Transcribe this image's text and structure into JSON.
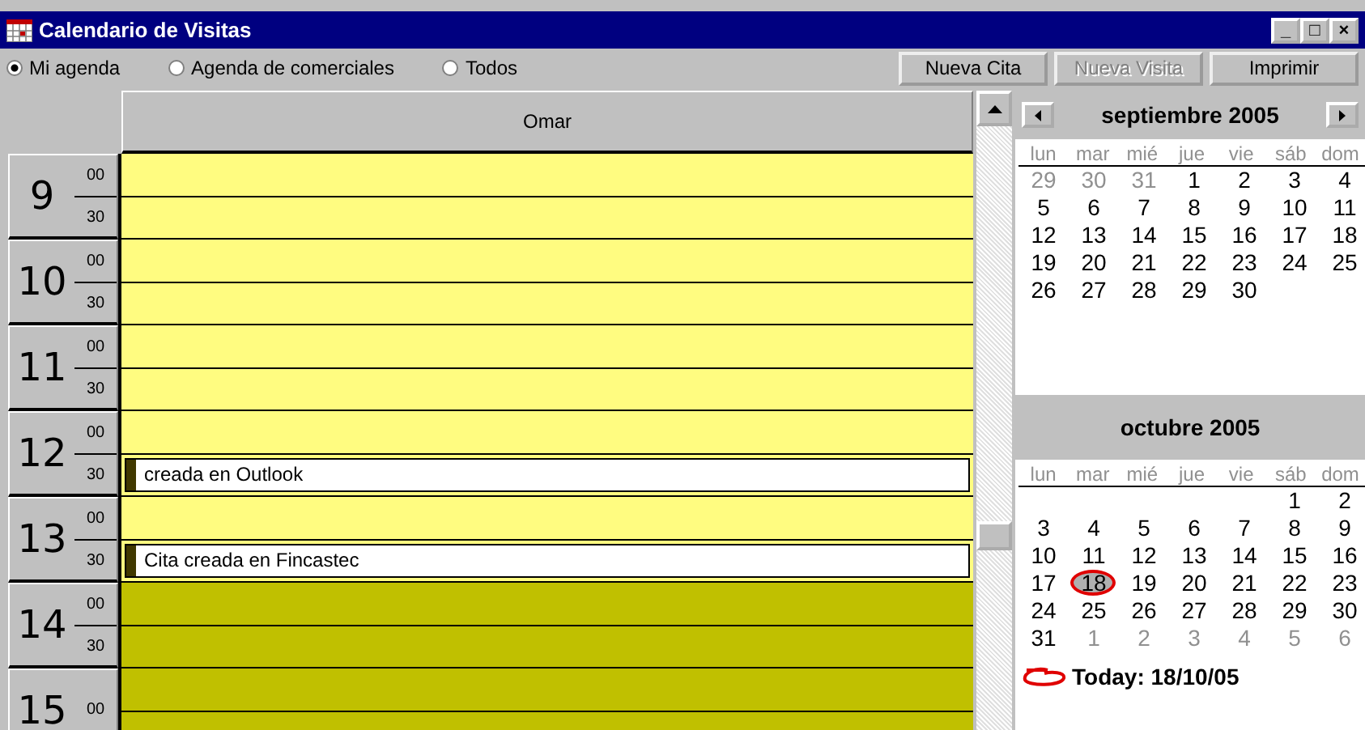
{
  "window": {
    "title": "Calendario de Visitas",
    "controls": [
      "_",
      "□",
      "×"
    ]
  },
  "view_options": [
    {
      "label": "Mi agenda",
      "selected": true
    },
    {
      "label": "Agenda de comerciales",
      "selected": false
    },
    {
      "label": "Todos",
      "selected": false
    }
  ],
  "buttons": [
    {
      "label": "Nueva Cita",
      "disabled": false
    },
    {
      "label": "Nueva Visita",
      "disabled": true
    },
    {
      "label": "Imprimir",
      "disabled": false
    }
  ],
  "schedule": {
    "column": "Omar",
    "hours": [
      {
        "hour": "9",
        "minutes": [
          "00",
          "30"
        ],
        "slots": [
          {
            "kind": "work"
          },
          {
            "kind": "work"
          }
        ]
      },
      {
        "hour": "10",
        "minutes": [
          "00",
          "30"
        ],
        "slots": [
          {
            "kind": "work"
          },
          {
            "kind": "work"
          }
        ]
      },
      {
        "hour": "11",
        "minutes": [
          "00",
          "30"
        ],
        "slots": [
          {
            "kind": "work"
          },
          {
            "kind": "work"
          }
        ]
      },
      {
        "hour": "12",
        "minutes": [
          "00",
          "30"
        ],
        "slots": [
          {
            "kind": "work"
          },
          {
            "kind": "work",
            "appointment": "creada en Outlook"
          }
        ]
      },
      {
        "hour": "13",
        "minutes": [
          "00",
          "30"
        ],
        "slots": [
          {
            "kind": "work"
          },
          {
            "kind": "work",
            "appointment": "Cita creada en Fincastec"
          }
        ]
      },
      {
        "hour": "14",
        "minutes": [
          "00",
          "30"
        ],
        "slots": [
          {
            "kind": "off"
          },
          {
            "kind": "off"
          }
        ]
      },
      {
        "hour": "15",
        "minutes": [
          "00"
        ],
        "slots": [
          {
            "kind": "off"
          },
          {
            "kind": "off"
          }
        ]
      }
    ]
  },
  "calendar": {
    "months": [
      {
        "title": "septiembre 2005",
        "kind": "navigable",
        "weekdays": [
          "lun",
          "mar",
          "mié",
          "jue",
          "vie",
          "sáb",
          "dom"
        ],
        "weeks": [
          [
            {
              "day": "29",
              "other": true,
              "selected": false
            },
            {
              "day": "30",
              "other": true,
              "selected": false
            },
            {
              "day": "31",
              "other": true,
              "selected": false
            },
            {
              "day": "1",
              "other": false,
              "selected": false
            },
            {
              "day": "2",
              "other": false,
              "selected": false
            },
            {
              "day": "3",
              "other": false,
              "selected": false
            },
            {
              "day": "4",
              "other": false,
              "selected": false
            }
          ],
          [
            {
              "day": "5",
              "other": false,
              "selected": false
            },
            {
              "day": "6",
              "other": false,
              "selected": false
            },
            {
              "day": "7",
              "other": false,
              "selected": false
            },
            {
              "day": "8",
              "other": false,
              "selected": false
            },
            {
              "day": "9",
              "other": false,
              "selected": false
            },
            {
              "day": "10",
              "other": false,
              "selected": false
            },
            {
              "day": "11",
              "other": false,
              "selected": false
            }
          ],
          [
            {
              "day": "12",
              "other": false,
              "selected": false
            },
            {
              "day": "13",
              "other": false,
              "selected": false
            },
            {
              "day": "14",
              "other": false,
              "selected": false
            },
            {
              "day": "15",
              "other": false,
              "selected": false
            },
            {
              "day": "16",
              "other": false,
              "selected": false
            },
            {
              "day": "17",
              "other": false,
              "selected": false
            },
            {
              "day": "18",
              "other": false,
              "selected": false
            }
          ],
          [
            {
              "day": "19",
              "other": false,
              "selected": false
            },
            {
              "day": "20",
              "other": false,
              "selected": false
            },
            {
              "day": "21",
              "other": false,
              "selected": false
            },
            {
              "day": "22",
              "other": false,
              "selected": false
            },
            {
              "day": "23",
              "other": false,
              "selected": false
            },
            {
              "day": "24",
              "other": false,
              "selected": false
            },
            {
              "day": "25",
              "other": false,
              "selected": false
            }
          ],
          [
            {
              "day": "26",
              "other": false,
              "selected": false
            },
            {
              "day": "27",
              "other": false,
              "selected": false
            },
            {
              "day": "28",
              "other": false,
              "selected": false
            },
            {
              "day": "29",
              "other": false,
              "selected": false
            },
            {
              "day": "30",
              "other": false,
              "selected": false
            }
          ]
        ]
      },
      {
        "title": "octubre 2005",
        "kind": "plain",
        "weekdays": [
          "lun",
          "mar",
          "mié",
          "jue",
          "vie",
          "sáb",
          "dom"
        ],
        "weeks": [
          [
            {
              "day": "1",
              "other": false,
              "selected": false
            },
            {
              "day": "2",
              "other": false,
              "selected": false
            }
          ],
          [
            {
              "day": "3",
              "other": false,
              "selected": false
            },
            {
              "day": "4",
              "other": false,
              "selected": false
            },
            {
              "day": "5",
              "other": false,
              "selected": false
            },
            {
              "day": "6",
              "other": false,
              "selected": false
            },
            {
              "day": "7",
              "other": false,
              "selected": false
            },
            {
              "day": "8",
              "other": false,
              "selected": false
            },
            {
              "day": "9",
              "other": false,
              "selected": false
            }
          ],
          [
            {
              "day": "10",
              "other": false,
              "selected": false
            },
            {
              "day": "11",
              "other": false,
              "selected": false
            },
            {
              "day": "12",
              "other": false,
              "selected": false
            },
            {
              "day": "13",
              "other": false,
              "selected": false
            },
            {
              "day": "14",
              "other": false,
              "selected": false
            },
            {
              "day": "15",
              "other": false,
              "selected": false
            },
            {
              "day": "16",
              "other": false,
              "selected": false
            }
          ],
          [
            {
              "day": "17",
              "other": false,
              "selected": false
            },
            {
              "day": "18",
              "other": false,
              "selected": true
            },
            {
              "day": "19",
              "other": false,
              "selected": false
            },
            {
              "day": "20",
              "other": false,
              "selected": false
            },
            {
              "day": "21",
              "other": false,
              "selected": false
            },
            {
              "day": "22",
              "other": false,
              "selected": false
            },
            {
              "day": "23",
              "other": false,
              "selected": false
            }
          ],
          [
            {
              "day": "24",
              "other": false,
              "selected": false
            },
            {
              "day": "25",
              "other": false,
              "selected": false
            },
            {
              "day": "26",
              "other": false,
              "selected": false
            },
            {
              "day": "27",
              "other": false,
              "selected": false
            },
            {
              "day": "28",
              "other": false,
              "selected": false
            },
            {
              "day": "29",
              "other": false,
              "selected": false
            },
            {
              "day": "30",
              "other": false,
              "selected": false
            }
          ],
          [
            {
              "day": "31",
              "other": false,
              "selected": false
            },
            {
              "day": "1",
              "other": true,
              "selected": false
            },
            {
              "day": "2",
              "other": true,
              "selected": false
            },
            {
              "day": "3",
              "other": true,
              "selected": false
            },
            {
              "day": "4",
              "other": true,
              "selected": false
            },
            {
              "day": "5",
              "other": true,
              "selected": false
            },
            {
              "day": "6",
              "other": true,
              "selected": false
            }
          ]
        ]
      }
    ],
    "today": "Today: 18/10/05"
  }
}
